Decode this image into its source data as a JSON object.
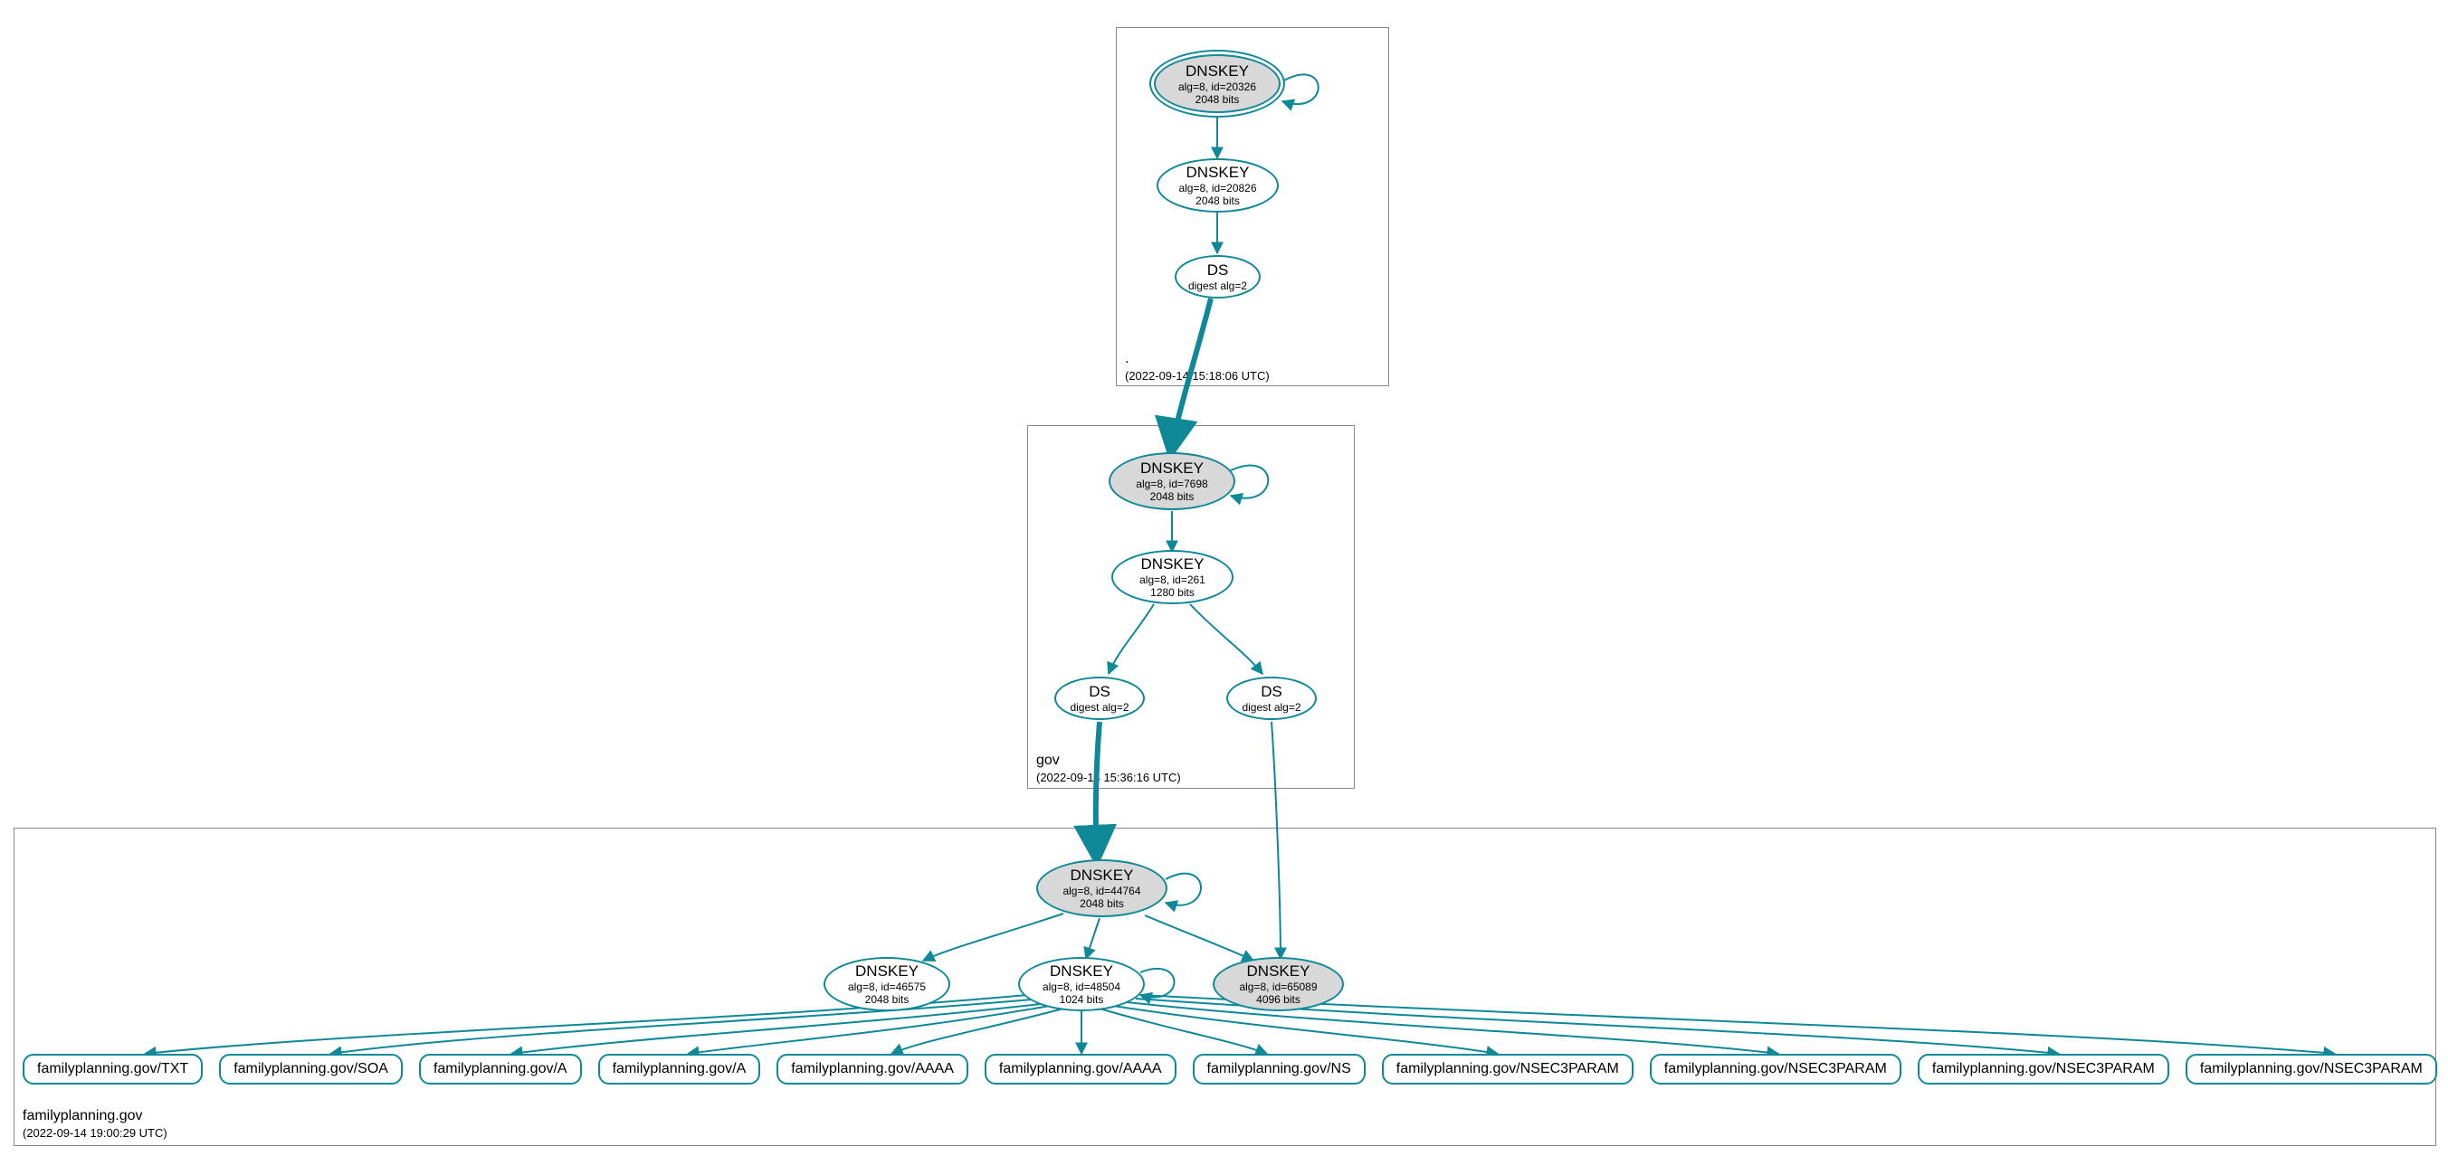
{
  "colors": {
    "edge": "#0f8898",
    "nodeStroke": "#0f8898",
    "fillGray": "#d8d8d8"
  },
  "zones": {
    "root": {
      "name": ".",
      "timestamp": "(2022-09-14 15:18:06 UTC)",
      "nodes": {
        "ksk": {
          "title": "DNSKEY",
          "sub1": "alg=8, id=20326",
          "sub2": "2048 bits"
        },
        "zsk": {
          "title": "DNSKEY",
          "sub1": "alg=8, id=20826",
          "sub2": "2048 bits"
        },
        "ds": {
          "title": "DS",
          "sub1": "digest alg=2"
        }
      }
    },
    "gov": {
      "name": "gov",
      "timestamp": "(2022-09-14 15:36:16 UTC)",
      "nodes": {
        "ksk": {
          "title": "DNSKEY",
          "sub1": "alg=8, id=7698",
          "sub2": "2048 bits"
        },
        "zsk": {
          "title": "DNSKEY",
          "sub1": "alg=8, id=261",
          "sub2": "1280 bits"
        },
        "ds1": {
          "title": "DS",
          "sub1": "digest alg=2"
        },
        "ds2": {
          "title": "DS",
          "sub1": "digest alg=2"
        }
      }
    },
    "family": {
      "name": "familyplanning.gov",
      "timestamp": "(2022-09-14 19:00:29 UTC)",
      "nodes": {
        "ksk": {
          "title": "DNSKEY",
          "sub1": "alg=8, id=44764",
          "sub2": "2048 bits"
        },
        "zsk_ext": {
          "title": "DNSKEY",
          "sub1": "alg=8, id=46575",
          "sub2": "2048 bits"
        },
        "zsk": {
          "title": "DNSKEY",
          "sub1": "alg=8, id=48504",
          "sub2": "1024 bits"
        },
        "ksk2": {
          "title": "DNSKEY",
          "sub1": "alg=8, id=65089",
          "sub2": "4096 bits"
        }
      }
    }
  },
  "rrsets": [
    "familyplanning.gov/TXT",
    "familyplanning.gov/SOA",
    "familyplanning.gov/A",
    "familyplanning.gov/A",
    "familyplanning.gov/AAAA",
    "familyplanning.gov/AAAA",
    "familyplanning.gov/NS",
    "familyplanning.gov/NSEC3PARAM",
    "familyplanning.gov/NSEC3PARAM",
    "familyplanning.gov/NSEC3PARAM",
    "familyplanning.gov/NSEC3PARAM"
  ]
}
